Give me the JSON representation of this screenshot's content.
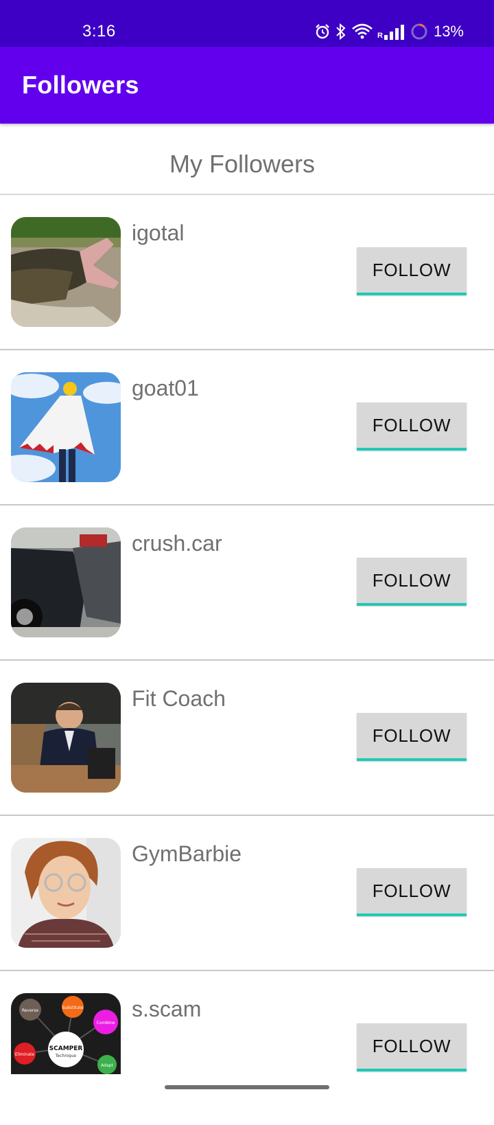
{
  "status_bar": {
    "time": "3:16",
    "battery_percent": "13%",
    "network_label": "R",
    "icons": [
      "alarm-icon",
      "bluetooth-icon",
      "wifi-icon",
      "signal-icon",
      "battery-saver-icon"
    ]
  },
  "app_bar": {
    "title": "Followers",
    "color": "#6200ee"
  },
  "section": {
    "title": "My Followers"
  },
  "followers": [
    {
      "username": "igotal",
      "button_label": "FOLLOW",
      "avatar": "alligator-photo"
    },
    {
      "username": "goat01",
      "button_label": "FOLLOW",
      "avatar": "anime-cloak-figure"
    },
    {
      "username": "crush.car",
      "button_label": "FOLLOW",
      "avatar": "car-crash-photo"
    },
    {
      "username": "Fit Coach",
      "button_label": "FOLLOW",
      "avatar": "coach-photo"
    },
    {
      "username": "GymBarbie",
      "button_label": "FOLLOW",
      "avatar": "woman-portrait"
    },
    {
      "username": "s.scam",
      "button_label": "FOLLOW",
      "avatar": "scamper-diagram"
    }
  ],
  "scamper_avatar": {
    "center_title": "SCAMPER",
    "center_subtitle": "Technique",
    "nodes": [
      "Reverse",
      "Substitute",
      "Combine",
      "Adapt",
      "Eliminate"
    ]
  },
  "colors": {
    "status_bar": "#3d00c4",
    "button_bg": "#d8d8d8",
    "button_accent": "#1ec9b6"
  }
}
